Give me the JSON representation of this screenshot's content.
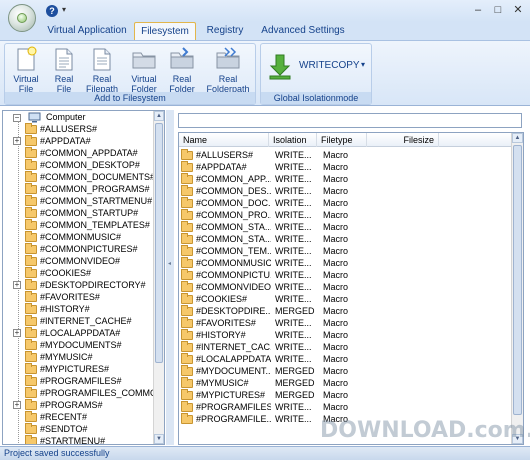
{
  "titlebar": {
    "help_glyph": "?",
    "qa_arrow": "▾",
    "win_min": "–",
    "win_max": "□",
    "win_close": "✕"
  },
  "tabs": [
    "Virtual Application",
    "Filesystem",
    "Registry",
    "Advanced Settings"
  ],
  "ribbon": {
    "group1_label": "Add to Filesystem",
    "group2_label": "Global Isolationmode",
    "buttons": [
      {
        "line1": "Virtual",
        "line2": "File",
        "icon": "virtual-file-icon"
      },
      {
        "line1": "Real",
        "line2": "File",
        "icon": "real-file-icon"
      },
      {
        "line1": "Real",
        "line2": "Filepath",
        "icon": "real-filepath-icon"
      },
      {
        "line1": "Virtual",
        "line2": "Folder",
        "icon": "virtual-folder-icon"
      },
      {
        "line1": "Real",
        "line2": "Folder",
        "icon": "real-folder-icon"
      },
      {
        "line1": "Real",
        "line2": "Folderpath",
        "icon": "real-folderpath-icon"
      }
    ],
    "writecopy_label": "WRITECOPY",
    "writecopy_arrow": "▾",
    "accent": "#15428b"
  },
  "tree": {
    "root": "Computer",
    "items": [
      {
        "label": "#ALLUSERS#",
        "expandable": false
      },
      {
        "label": "#APPDATA#",
        "expandable": true
      },
      {
        "label": "#COMMON_APPDATA#",
        "expandable": false
      },
      {
        "label": "#COMMON_DESKTOP#",
        "expandable": false
      },
      {
        "label": "#COMMON_DOCUMENTS#",
        "expandable": false
      },
      {
        "label": "#COMMON_PROGRAMS#",
        "expandable": false
      },
      {
        "label": "#COMMON_STARTMENU#",
        "expandable": false
      },
      {
        "label": "#COMMON_STARTUP#",
        "expandable": false
      },
      {
        "label": "#COMMON_TEMPLATES#",
        "expandable": false
      },
      {
        "label": "#COMMONMUSIC#",
        "expandable": false
      },
      {
        "label": "#COMMONPICTURES#",
        "expandable": false
      },
      {
        "label": "#COMMONVIDEO#",
        "expandable": false
      },
      {
        "label": "#COOKIES#",
        "expandable": false
      },
      {
        "label": "#DESKTOPDIRECTORY#",
        "expandable": true
      },
      {
        "label": "#FAVORITES#",
        "expandable": false
      },
      {
        "label": "#HISTORY#",
        "expandable": false
      },
      {
        "label": "#INTERNET_CACHE#",
        "expandable": false
      },
      {
        "label": "#LOCALAPPDATA#",
        "expandable": true
      },
      {
        "label": "#MYDOCUMENTS#",
        "expandable": false
      },
      {
        "label": "#MYMUSIC#",
        "expandable": false
      },
      {
        "label": "#MYPICTURES#",
        "expandable": false
      },
      {
        "label": "#PROGRAMFILES#",
        "expandable": false
      },
      {
        "label": "#PROGRAMFILES_COMMO",
        "expandable": false
      },
      {
        "label": "#PROGRAMS#",
        "expandable": true
      },
      {
        "label": "#RECENT#",
        "expandable": false
      },
      {
        "label": "#SENDTO#",
        "expandable": false
      },
      {
        "label": "#STARTMENU#",
        "expandable": false
      }
    ]
  },
  "path": "",
  "list": {
    "columns": [
      "Name",
      "Isolation",
      "Filetype",
      "Filesize"
    ],
    "rows": [
      [
        "#ALLUSERS#",
        "WRITE...",
        "Macro",
        ""
      ],
      [
        "#APPDATA#",
        "WRITE...",
        "Macro",
        ""
      ],
      [
        "#COMMON_APP...",
        "WRITE...",
        "Macro",
        ""
      ],
      [
        "#COMMON_DES...",
        "WRITE...",
        "Macro",
        ""
      ],
      [
        "#COMMON_DOC...",
        "WRITE...",
        "Macro",
        ""
      ],
      [
        "#COMMON_PRO...",
        "WRITE...",
        "Macro",
        ""
      ],
      [
        "#COMMON_STA...",
        "WRITE...",
        "Macro",
        ""
      ],
      [
        "#COMMON_STA...",
        "WRITE...",
        "Macro",
        ""
      ],
      [
        "#COMMON_TEM...",
        "WRITE...",
        "Macro",
        ""
      ],
      [
        "#COMMONMUSIC#",
        "WRITE...",
        "Macro",
        ""
      ],
      [
        "#COMMONPICTU...",
        "WRITE...",
        "Macro",
        ""
      ],
      [
        "#COMMONVIDEO#",
        "WRITE...",
        "Macro",
        ""
      ],
      [
        "#COOKIES#",
        "WRITE...",
        "Macro",
        ""
      ],
      [
        "#DESKTOPDIRE...",
        "MERGED",
        "Macro",
        ""
      ],
      [
        "#FAVORITES#",
        "WRITE...",
        "Macro",
        ""
      ],
      [
        "#HISTORY#",
        "WRITE...",
        "Macro",
        ""
      ],
      [
        "#INTERNET_CAC...",
        "WRITE...",
        "Macro",
        ""
      ],
      [
        "#LOCALAPPDATA#",
        "WRITE...",
        "Macro",
        ""
      ],
      [
        "#MYDOCUMENT...",
        "MERGED",
        "Macro",
        ""
      ],
      [
        "#MYMUSIC#",
        "MERGED",
        "Macro",
        ""
      ],
      [
        "#MYPICTURES#",
        "MERGED",
        "Macro",
        ""
      ],
      [
        "#PROGRAMFILES#",
        "WRITE...",
        "Macro",
        ""
      ],
      [
        "#PROGRAMFILE...",
        "WRITE...",
        "Macro",
        ""
      ]
    ]
  },
  "status": "Project saved successfully",
  "watermark": "DOWNLOAD.com.vn"
}
